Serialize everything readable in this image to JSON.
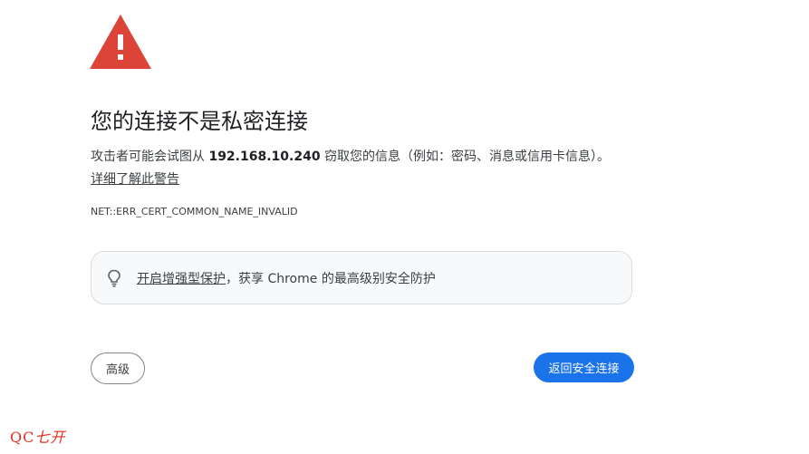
{
  "heading": "您的连接不是私密连接",
  "message": {
    "before": "攻击者可能会试图从 ",
    "host": "192.168.10.240",
    "after": " 窃取您的信息（例如：密码、消息或信用卡信息）。"
  },
  "details_link": "详细了解此警告",
  "error_code": "NET::ERR_CERT_COMMON_NAME_INVALID",
  "enhanced_protection": {
    "link_text": "开启增强型保护",
    "rest_text": "，获享 Chrome 的最高级别安全防护",
    "icon": "lightbulb-icon"
  },
  "buttons": {
    "advanced": "高级",
    "back_to_safety": "返回安全连接"
  },
  "watermark": {
    "latin": "QC",
    "cn": "七开"
  },
  "colors": {
    "warning_red": "#db4437",
    "primary_blue": "#1a73e8"
  }
}
